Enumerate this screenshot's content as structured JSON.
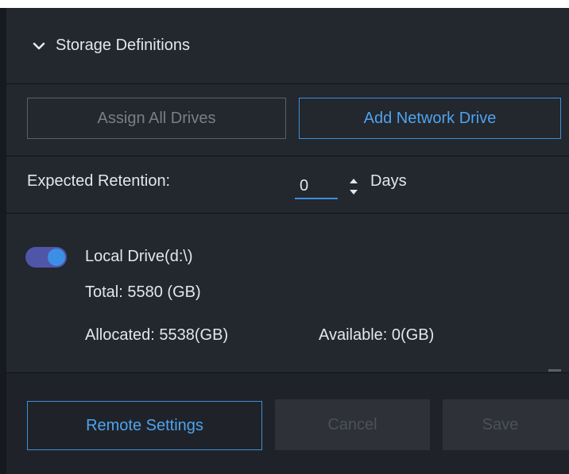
{
  "section": {
    "title": "Storage Definitions",
    "icon": "chevron-down-icon"
  },
  "buttons": {
    "assign_all": "Assign All Drives",
    "add_network": "Add Network Drive"
  },
  "retention": {
    "label": "Expected Retention:",
    "value": "0",
    "unit": "Days"
  },
  "drive": {
    "enabled": true,
    "name": "Local Drive(d:\\)",
    "total": "Total: 5580 (GB)",
    "allocated": "Allocated: 5538(GB)",
    "available": "Available: 0(GB)"
  },
  "footer": {
    "remote_settings": "Remote Settings",
    "cancel": "Cancel",
    "save": "Save"
  },
  "colors": {
    "background": "#23272e",
    "accent_blue": "#3d8fd9",
    "toggle_track": "#4f56a8",
    "text": "#e4e6ea",
    "disabled_text": "#4c5057"
  }
}
